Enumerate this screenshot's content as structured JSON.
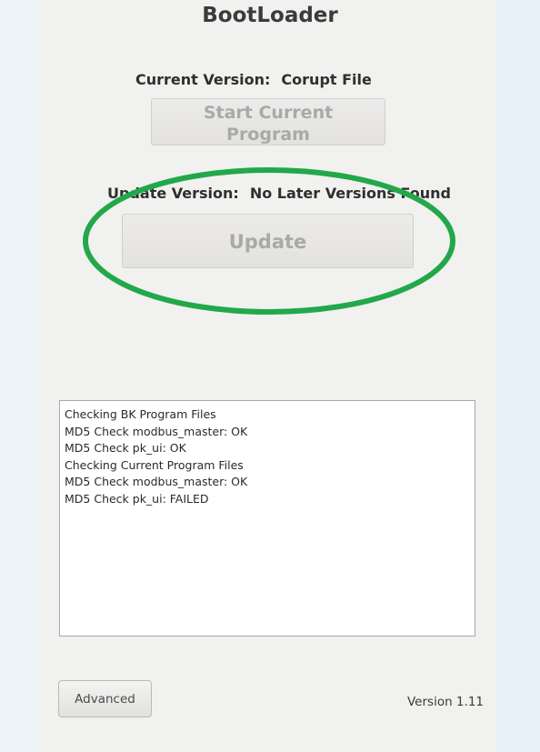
{
  "window": {
    "title": "BootLoader"
  },
  "current": {
    "label": "Current Version:",
    "value": "Corupt File",
    "start_button_line1": "Start Current",
    "start_button_line2": "Program"
  },
  "update": {
    "label": "Update Version:",
    "value": "No Later Versions Found",
    "button_label": "Update"
  },
  "highlight": {
    "color": "#22a84a",
    "icon": "green-ellipse-annotation"
  },
  "log": {
    "lines": [
      "Checking BK Program Files",
      "MD5 Check modbus_master: OK",
      "MD5 Check pk_ui: OK",
      "Checking Current Program Files",
      "MD5 Check modbus_master: OK",
      "MD5 Check pk_ui: FAILED"
    ]
  },
  "footer": {
    "advanced_label": "Advanced",
    "version_text": "Version 1.11"
  }
}
